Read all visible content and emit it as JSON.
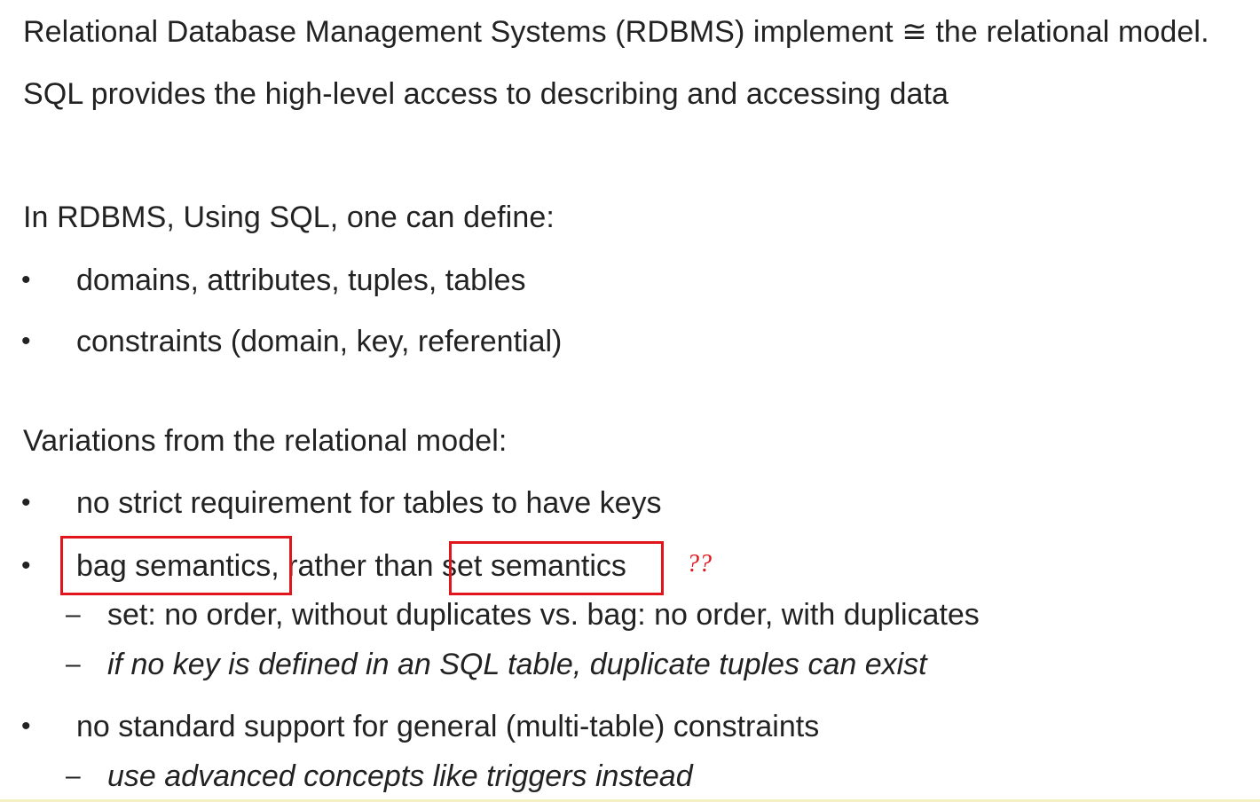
{
  "intro": {
    "line1": "Relational Database Management Systems (RDBMS) implement ≅ the relational model.",
    "line2": "SQL provides the high-level access to describing and accessing data"
  },
  "define": {
    "heading": "In RDBMS, Using SQL, one can define:",
    "items": [
      "domains, attributes, tuples, tables",
      "constraints (domain, key, referential)"
    ]
  },
  "variations": {
    "heading": "Variations from the relational model:",
    "item1": "no strict requirement for tables to have keys",
    "item2": {
      "part1": "bag semantics,",
      "part2": " rather than ",
      "part3": "set semantics",
      "sub1": "set: no order, without duplicates vs. bag: no order, with duplicates",
      "sub2": "if no key is defined in an SQL table, duplicate tuples can exist"
    },
    "item3": {
      "text": "no standard support for general (multi-table) constraints",
      "sub1": "use advanced concepts like triggers instead"
    }
  },
  "annotation": {
    "question_marks": "??",
    "color": "#e0161c"
  },
  "symbols": {
    "bullet": "•",
    "dash": "–"
  }
}
